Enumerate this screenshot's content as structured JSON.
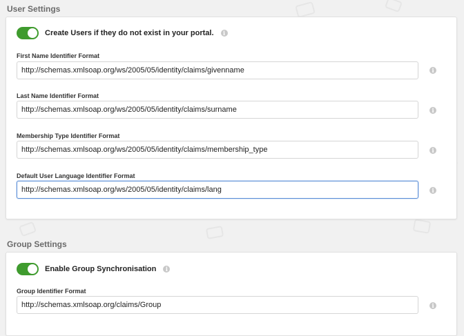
{
  "user_settings": {
    "title": "User Settings",
    "toggle": {
      "label": "Create Users if they do not exist in your portal.",
      "on": true
    },
    "fields": [
      {
        "label": "First Name Identifier Format",
        "value": "http://schemas.xmlsoap.org/ws/2005/05/identity/claims/givenname"
      },
      {
        "label": "Last Name Identifier Format",
        "value": "http://schemas.xmlsoap.org/ws/2005/05/identity/claims/surname"
      },
      {
        "label": "Membership Type Identifier Format",
        "value": "http://schemas.xmlsoap.org/ws/2005/05/identity/claims/membership_type"
      },
      {
        "label": "Default User Language Identifier Format",
        "value": "http://schemas.xmlsoap.org/ws/2005/05/identity/claims/lang"
      }
    ]
  },
  "group_settings": {
    "title": "Group Settings",
    "toggle": {
      "label": "Enable Group Synchronisation",
      "on": true
    },
    "fields": [
      {
        "label": "Group Identifier Format",
        "value": "http://schemas.xmlsoap.org/claims/Group"
      }
    ]
  },
  "colors": {
    "toggle_on": "#3f9b2e",
    "focus_border": "#5d8fd6",
    "background": "#f1f1f1"
  },
  "icons": {
    "info": "info-icon",
    "toggle_knob": "toggle-knob"
  }
}
